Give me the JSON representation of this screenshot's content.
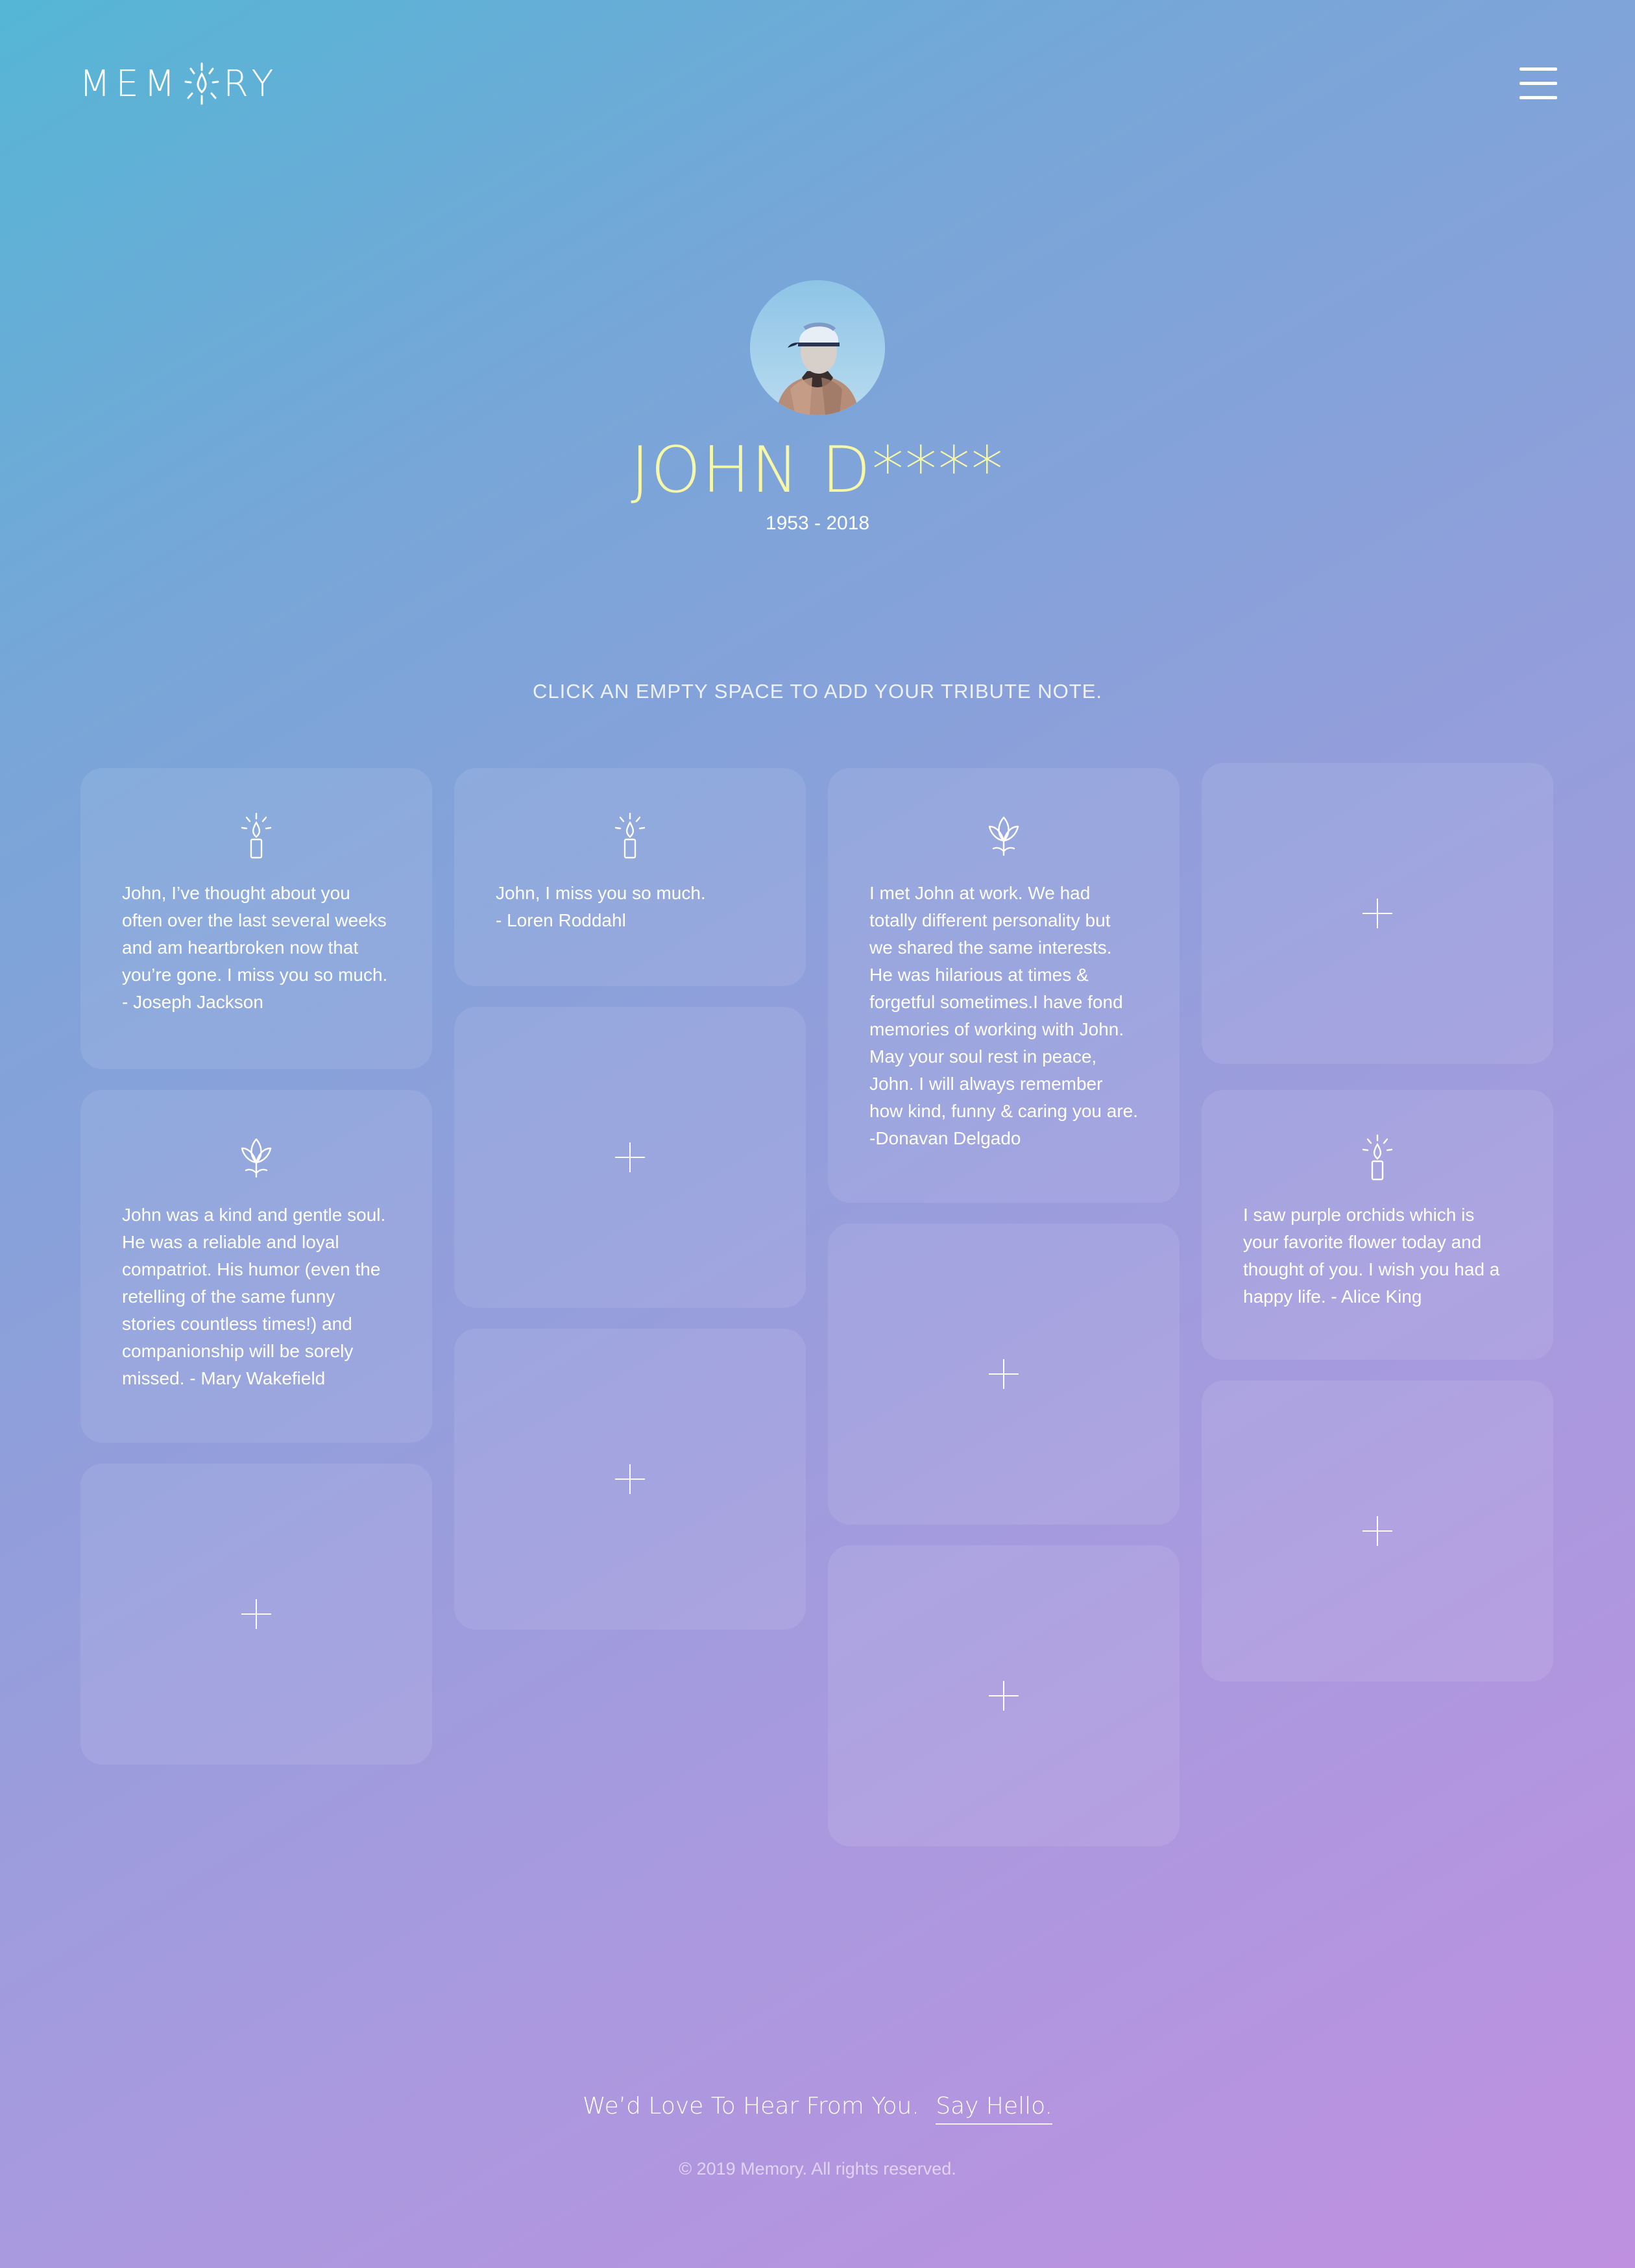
{
  "brand": {
    "logo_text_left": "MEM",
    "logo_text_right": "RY"
  },
  "header": {
    "menu_icon": "hamburger-menu-icon"
  },
  "profile": {
    "name": "JOHN D****",
    "years": "1953 - 2018",
    "name_color": "#f6f7a7"
  },
  "instructions": "CLICK AN EMPTY SPACE TO ADD YOUR TRIBUTE NOTE.",
  "tributes": [
    {
      "icon": "candle-icon",
      "text": "John, I’ve thought about you often over the last several weeks and am heartbroken now that you’re gone. I miss you so much. - Joseph Jackson"
    },
    {
      "icon": "candle-icon",
      "text": "John, I miss you so much.\n- Loren Roddahl"
    },
    {
      "icon": "lotus-icon",
      "text": "I met John at work. We had totally different personality but we shared the same interests. He was hilarious at times & forgetful sometimes.I have fond memories of working with John. May your soul rest in peace, John. I will always remember how kind, funny & caring you are. -Donavan Delgado"
    },
    {
      "icon": "lotus-icon",
      "text": "John was a kind and gentle soul. He was a reliable and loyal compatriot. His humor (even the retelling of the same funny stories countless times!) and companionship will be sorely missed.  - Mary Wakefield"
    },
    {
      "icon": "candle-icon",
      "text": "I saw purple orchids which is your favorite flower today and thought of you. I wish you had a happy life. - Alice King"
    }
  ],
  "empty_slot_icon": "plus-icon",
  "footer": {
    "message": "We’d Love To Hear From You.",
    "link": "Say Hello.",
    "copyright": "© 2019 Memory. All rights reserved."
  }
}
